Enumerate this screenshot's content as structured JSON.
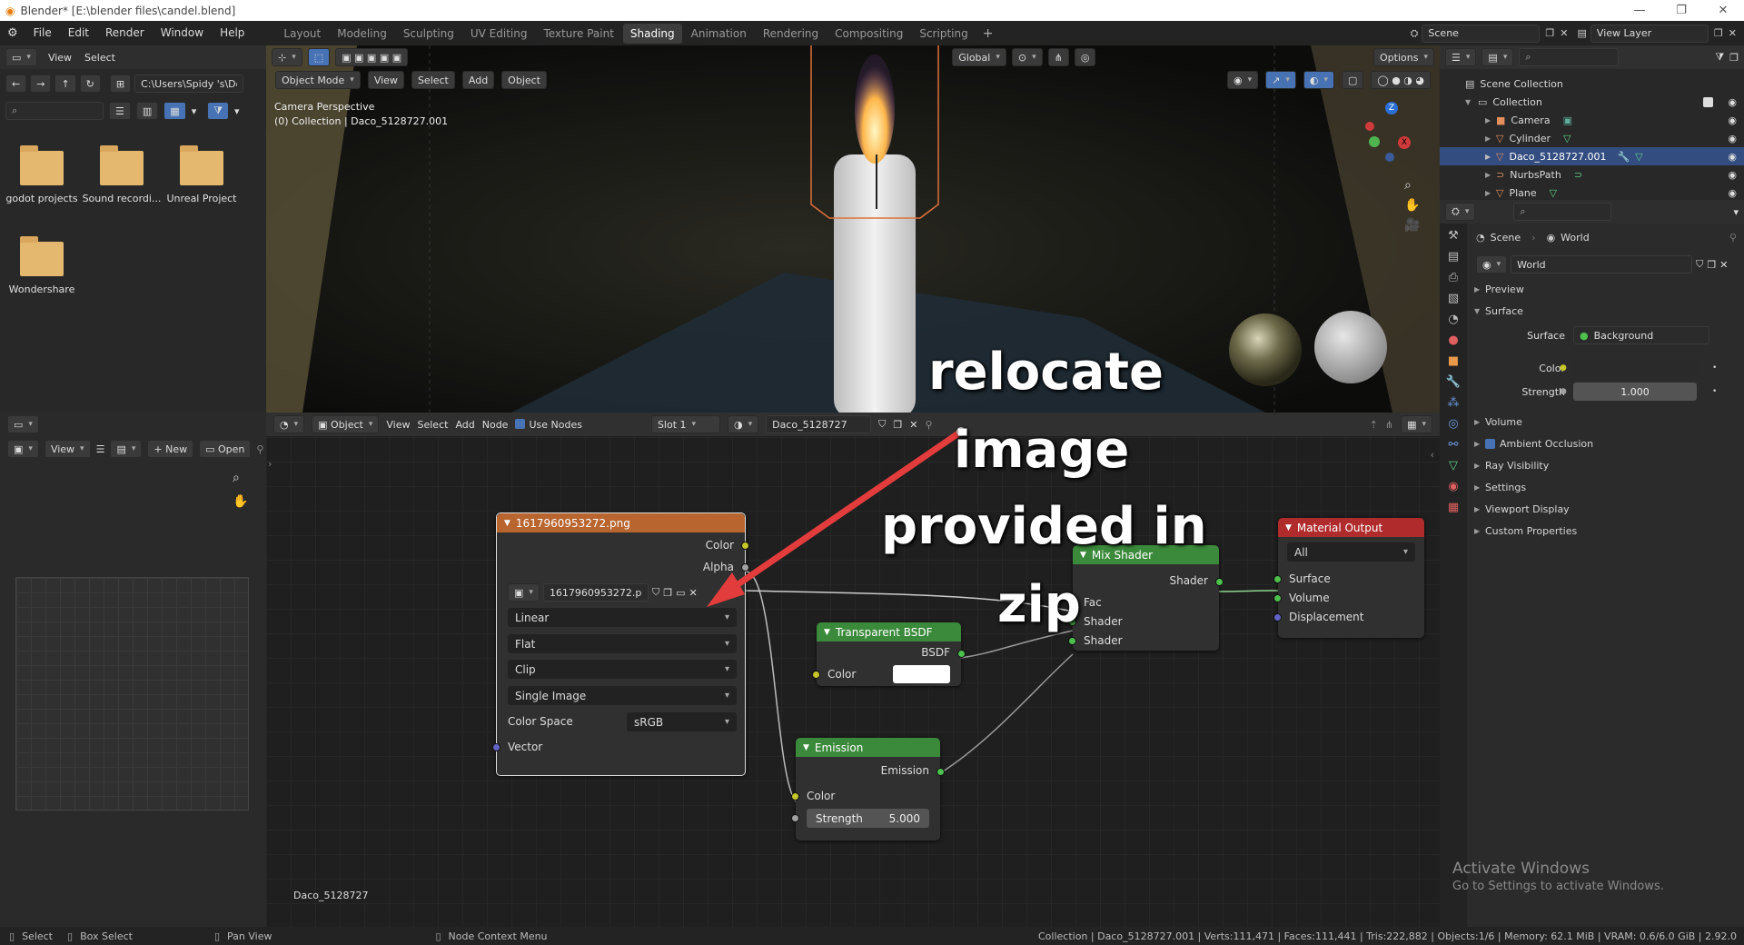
{
  "window": {
    "title": "Blender* [E:\\blender files\\candel.blend]",
    "controls": [
      "—",
      "❐",
      "✕"
    ]
  },
  "menu": [
    "File",
    "Edit",
    "Render",
    "Window",
    "Help"
  ],
  "workspaces": [
    "Layout",
    "Modeling",
    "Sculpting",
    "UV Editing",
    "Texture Paint",
    "Shading",
    "Animation",
    "Rendering",
    "Compositing",
    "Scripting"
  ],
  "active_workspace": "Shading",
  "scene": {
    "label": "Scene",
    "view_layer": "View Layer"
  },
  "filebrowser": {
    "menu": [
      "View",
      "Select"
    ],
    "path": "C:\\Users\\Spidy 's\\Doc...",
    "folders": [
      "godot projects",
      "Sound recordi...",
      "Unreal Project",
      "Wondershare"
    ]
  },
  "viewport": {
    "mode": "Object Mode",
    "menu": [
      "View",
      "Select",
      "Add",
      "Object"
    ],
    "transform": "Global",
    "options": "Options",
    "info_line1": "Camera Perspective",
    "info_line2": "(0) Collection | Daco_5128727.001"
  },
  "node_editor": {
    "type": "Object",
    "menu": [
      "View",
      "Select",
      "Add",
      "Node"
    ],
    "use_nodes": "Use Nodes",
    "slot": "Slot 1",
    "material": "Daco_5128727",
    "footer_label": "Daco_5128727",
    "image_node": {
      "title": "1617960953272.png",
      "out_color": "Color",
      "out_alpha": "Alpha",
      "image_name": "1617960953272.p...",
      "interpolation": "Linear",
      "projection": "Flat",
      "extension": "Clip",
      "source": "Single Image",
      "colorspace_label": "Color Space",
      "colorspace": "sRGB",
      "in_vector": "Vector"
    },
    "transparent_node": {
      "title": "Transparent BSDF",
      "out": "BSDF",
      "in_color": "Color"
    },
    "emission_node": {
      "title": "Emission",
      "out": "Emission",
      "in_color": "Color",
      "strength_label": "Strength",
      "strength": "5.000"
    },
    "mix_node": {
      "title": "Mix Shader",
      "out": "Shader",
      "in_fac": "Fac",
      "in_shader1": "Shader",
      "in_shader2": "Shader"
    },
    "output_node": {
      "title": "Material Output",
      "target": "All",
      "surface": "Surface",
      "volume": "Volume",
      "displacement": "Displacement"
    }
  },
  "image_editor": {
    "view": "View",
    "new": "New",
    "open": "Open"
  },
  "annotation": {
    "line1": "relocate",
    "line2": "image",
    "line3": "provided in",
    "line4": "zip"
  },
  "outliner": {
    "root": "Scene Collection",
    "collection": "Collection",
    "items": [
      "Camera",
      "Cylinder",
      "Daco_5128727.001",
      "NurbsPath",
      "Plane"
    ],
    "selected": "Daco_5128727.001"
  },
  "properties": {
    "breadcrumb_scene": "Scene",
    "breadcrumb_world": "World",
    "world_name": "World",
    "sections": [
      "Preview",
      "Surface"
    ],
    "surface_label": "Surface",
    "surface_value": "Background",
    "color_label": "Color",
    "strength_label": "Strength",
    "strength_value": "1.000",
    "collapsed_sections": [
      "Volume",
      "Ambient Occlusion",
      "Ray Visibility",
      "Settings",
      "Viewport Display",
      "Custom Properties"
    ]
  },
  "watermark": {
    "line1": "Activate Windows",
    "line2": "Go to Settings to activate Windows."
  },
  "status": {
    "select": "Select",
    "box_select": "Box Select",
    "pan_view": "Pan View",
    "context_menu": "Node Context Menu",
    "stats": "Collection | Daco_5128727.001 | Verts:111,471 | Faces:111,441 | Tris:222,882 | Objects:1/6 | Memory: 62.1 MiB | VRAM: 0.6/6.0 GiB | 2.92.0"
  },
  "colors": {
    "image_node_header": "#b8652f",
    "shader_header": "#3b8a3b",
    "output_header": "#b02b2b",
    "selection": "#334d80",
    "arrow": "#e33c3c"
  }
}
